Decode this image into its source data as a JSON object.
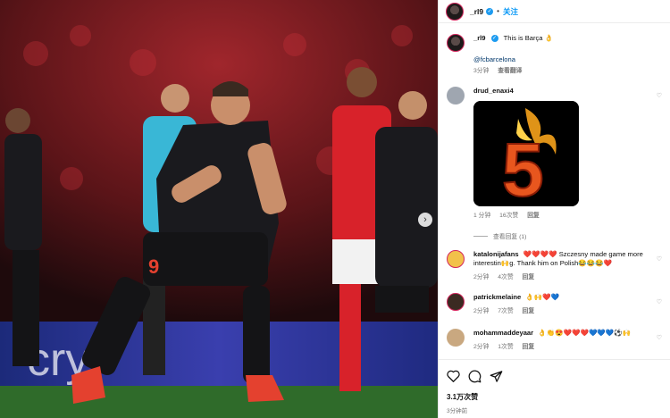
{
  "post": {
    "author": "_rl9",
    "follow_label": "关注",
    "dot": "•",
    "likes": "3.1万次赞",
    "time": "3分钟前"
  },
  "caption": {
    "author": "_rl9",
    "text": "This is Barça",
    "emoji": "👌",
    "mention": "@fcbarcelona",
    "time": "3分钟",
    "translate": "查看翻译"
  },
  "comments": [
    {
      "user": "drud_enaxi4",
      "text": "",
      "time": "1 分钟",
      "likes": "16次赞",
      "reply": "回复",
      "view_replies": "查看回复 (1)",
      "gif_text": "5"
    },
    {
      "user": "katalonijafans",
      "text": "❤️❤️❤️❤️ Szczesny made game more interestin🙌g. Thank him on Polish😂😂😂❤️",
      "time": "2分钟",
      "likes": "4次赞",
      "reply": "回复"
    },
    {
      "user": "patrickmelaine",
      "text": "👌🙌❤️💙",
      "time": "2分钟",
      "likes": "7次赞",
      "reply": "回复"
    },
    {
      "user": "mohammaddeyaar",
      "text": "👌👏😍❤️❤️❤️💙💙💙⚽🙌",
      "time": "2分钟",
      "likes": "1次赞",
      "reply": "回复"
    }
  ],
  "photo": {
    "shirt_number": "9",
    "sign_text": "cryr",
    "colors": {
      "crowd": "#7a1d22",
      "kit": "#1a1a1e",
      "benfica": "#d8222a",
      "pitch": "#2f6b2a"
    }
  },
  "icons": [
    "heart-icon",
    "comment-icon",
    "share-icon",
    "verified-icon",
    "next-arrow-icon"
  ]
}
